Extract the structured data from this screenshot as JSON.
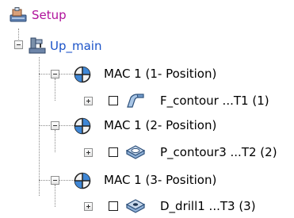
{
  "tree": {
    "root": {
      "label": "Setup"
    },
    "machine": {
      "label": "Up_main"
    },
    "positions": [
      {
        "label": "MAC 1 (1- Position)",
        "operation": {
          "label": "F_contour ...T1 (1)",
          "icon": "contour-operation-icon"
        }
      },
      {
        "label": "MAC 1 (2- Position)",
        "operation": {
          "label": "P_contour3 ...T2 (2)",
          "icon": "pocket-operation-icon"
        }
      },
      {
        "label": "MAC 1 (3- Position)",
        "operation": {
          "label": "D_drill1 ...T3 (3)",
          "icon": "drill-operation-icon"
        }
      }
    ]
  },
  "colors": {
    "setup": "#b0119b",
    "up_main": "#1a52c8",
    "lines": "#8a8a8a"
  }
}
